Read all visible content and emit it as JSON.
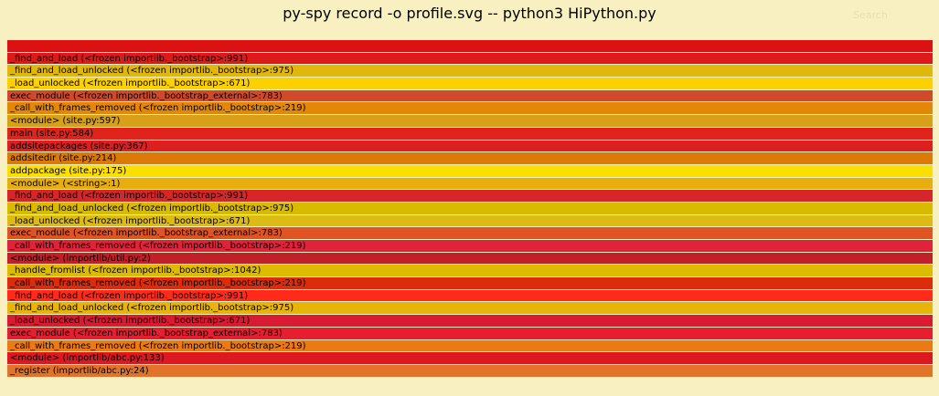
{
  "header": {
    "title": "py-spy record -o profile.svg -- python3 HiPython.py",
    "search_label": "Search"
  },
  "frames": [
    {
      "label": "",
      "color": "#dc1212"
    },
    {
      "label": "_find_and_load (<frozen importlib._bootstrap>:991)",
      "color": "#dc1a1a"
    },
    {
      "label": "_find_and_load_unlocked (<frozen importlib._bootstrap>:975)",
      "color": "#e0b70d"
    },
    {
      "label": "_load_unlocked (<frozen importlib._bootstrap>:671)",
      "color": "#fcd100"
    },
    {
      "label": "exec_module (<frozen importlib._bootstrap_external>:783)",
      "color": "#cf4a2a"
    },
    {
      "label": "_call_with_frames_removed (<frozen importlib._bootstrap>:219)",
      "color": "#e38709"
    },
    {
      "label": "<module> (site.py:597)",
      "color": "#d89f18"
    },
    {
      "label": "main (site.py:584)",
      "color": "#e0241c"
    },
    {
      "label": "addsitepackages (site.py:367)",
      "color": "#dc2020"
    },
    {
      "label": "addsitedir (site.py:214)",
      "color": "#dc7a07"
    },
    {
      "label": "addpackage (site.py:175)",
      "color": "#fbdf00"
    },
    {
      "label": "<module> (<string>:1)",
      "color": "#e8ae0b"
    },
    {
      "label": "_find_and_load (<frozen importlib._bootstrap>:991)",
      "color": "#d5262a"
    },
    {
      "label": "_find_and_load_unlocked (<frozen importlib._bootstrap>:975)",
      "color": "#d8ba00"
    },
    {
      "label": "_load_unlocked (<frozen importlib._bootstrap>:671)",
      "color": "#dcbc14"
    },
    {
      "label": "exec_module (<frozen importlib._bootstrap_external>:783)",
      "color": "#e05323"
    },
    {
      "label": "_call_with_frames_removed (<frozen importlib._bootstrap>:219)",
      "color": "#e0233a"
    },
    {
      "label": "<module> (importlib/util.py:2)",
      "color": "#c11f2a"
    },
    {
      "label": "_handle_fromlist (<frozen importlib._bootstrap>:1042)",
      "color": "#dcbb00"
    },
    {
      "label": "_call_with_frames_removed (<frozen importlib._bootstrap>:219)",
      "color": "#dc2c0c"
    },
    {
      "label": "_find_and_load (<frozen importlib._bootstrap>:991)",
      "color": "#ff2a1a"
    },
    {
      "label": "_find_and_load_unlocked (<frozen importlib._bootstrap>:975)",
      "color": "#e7b40a"
    },
    {
      "label": "_load_unlocked (<frozen importlib._bootstrap>:671)",
      "color": "#d81a32"
    },
    {
      "label": "exec_module (<frozen importlib._bootstrap_external>:783)",
      "color": "#e51e32"
    },
    {
      "label": "_call_with_frames_removed (<frozen importlib._bootstrap>:219)",
      "color": "#ec7a14"
    },
    {
      "label": "<module> (importlib/abc.py:133)",
      "color": "#dc1820"
    },
    {
      "label": "_register (importlib/abc.py:24)",
      "color": "#e0742a"
    }
  ]
}
